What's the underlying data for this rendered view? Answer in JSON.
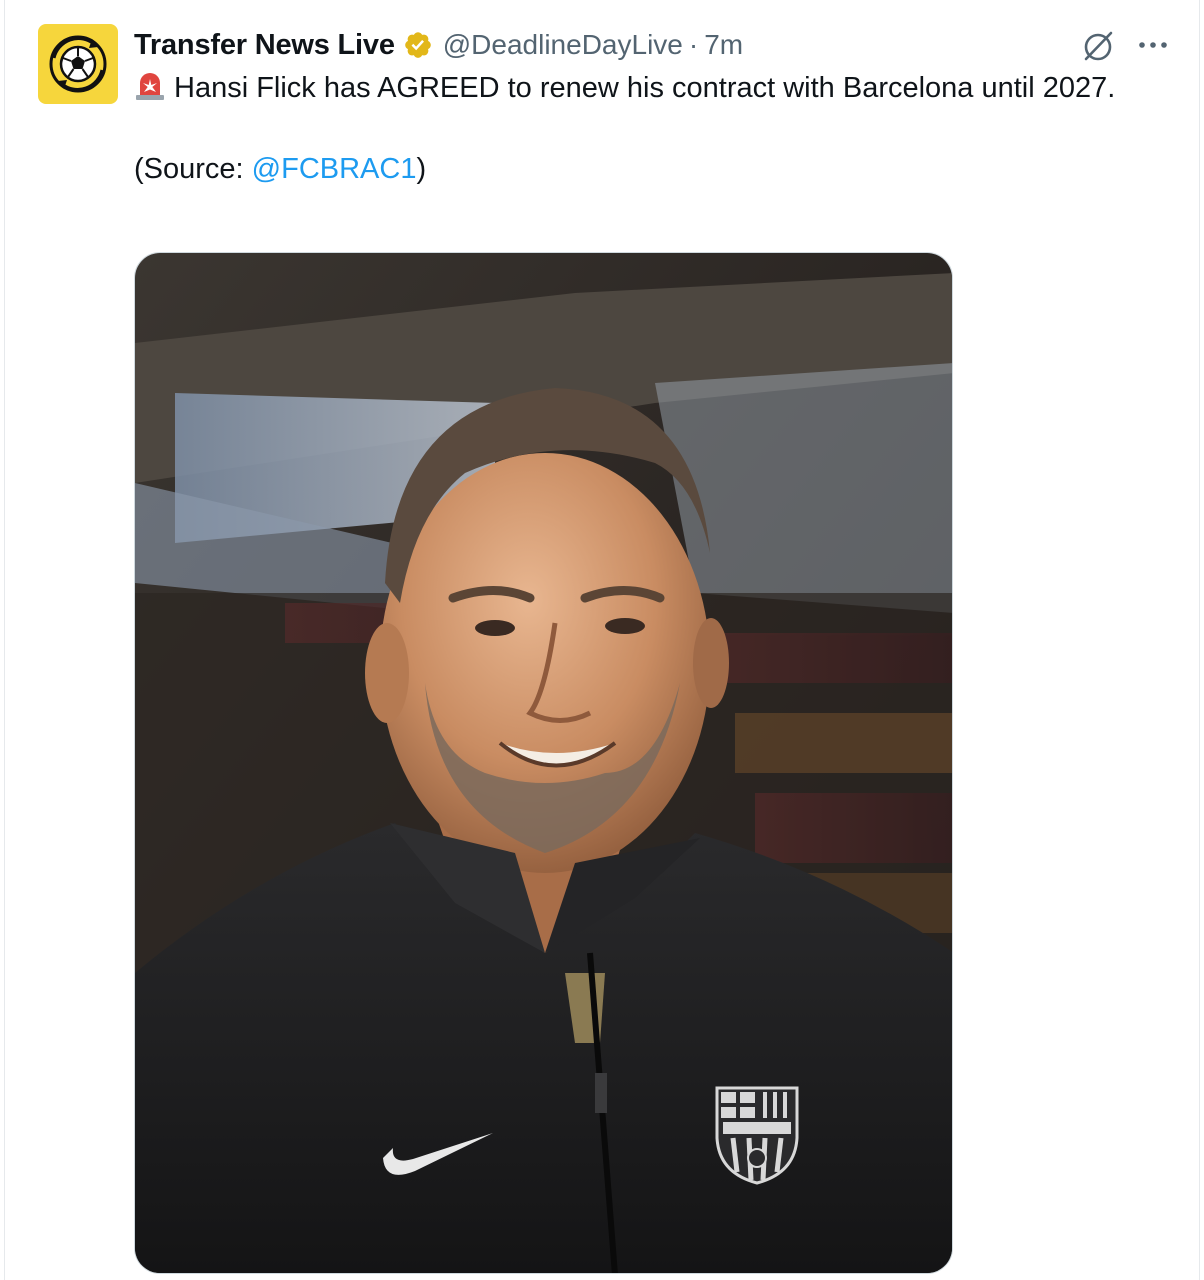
{
  "tweet": {
    "author": {
      "display_name": "Transfer News Live",
      "handle": "@DeadlineDayLive",
      "verified": true,
      "avatar_icon": "football-recycle-logo-icon",
      "avatar_color": "#f6d63c"
    },
    "separator": "·",
    "time": "7m",
    "text": {
      "emoji_icon": "rotating-light-siren-icon",
      "line1": "Hansi Flick has AGREED to renew his contract with Barcelona until 2027.",
      "source_prefix": "(Source: ",
      "source_mention": "@FCBRAC1",
      "source_suffix": ")"
    },
    "actions": {
      "grok_icon": "grok-icon",
      "more_icon": "more-options-icon"
    },
    "media": {
      "type": "photo",
      "description_icon": "photo-of-man-in-black-fcb-nike-jacket"
    }
  },
  "colors": {
    "link": "#1d9bf0",
    "secondary_text": "#536471",
    "primary_text": "#0f1419",
    "verified_badge": "#e2b719"
  }
}
